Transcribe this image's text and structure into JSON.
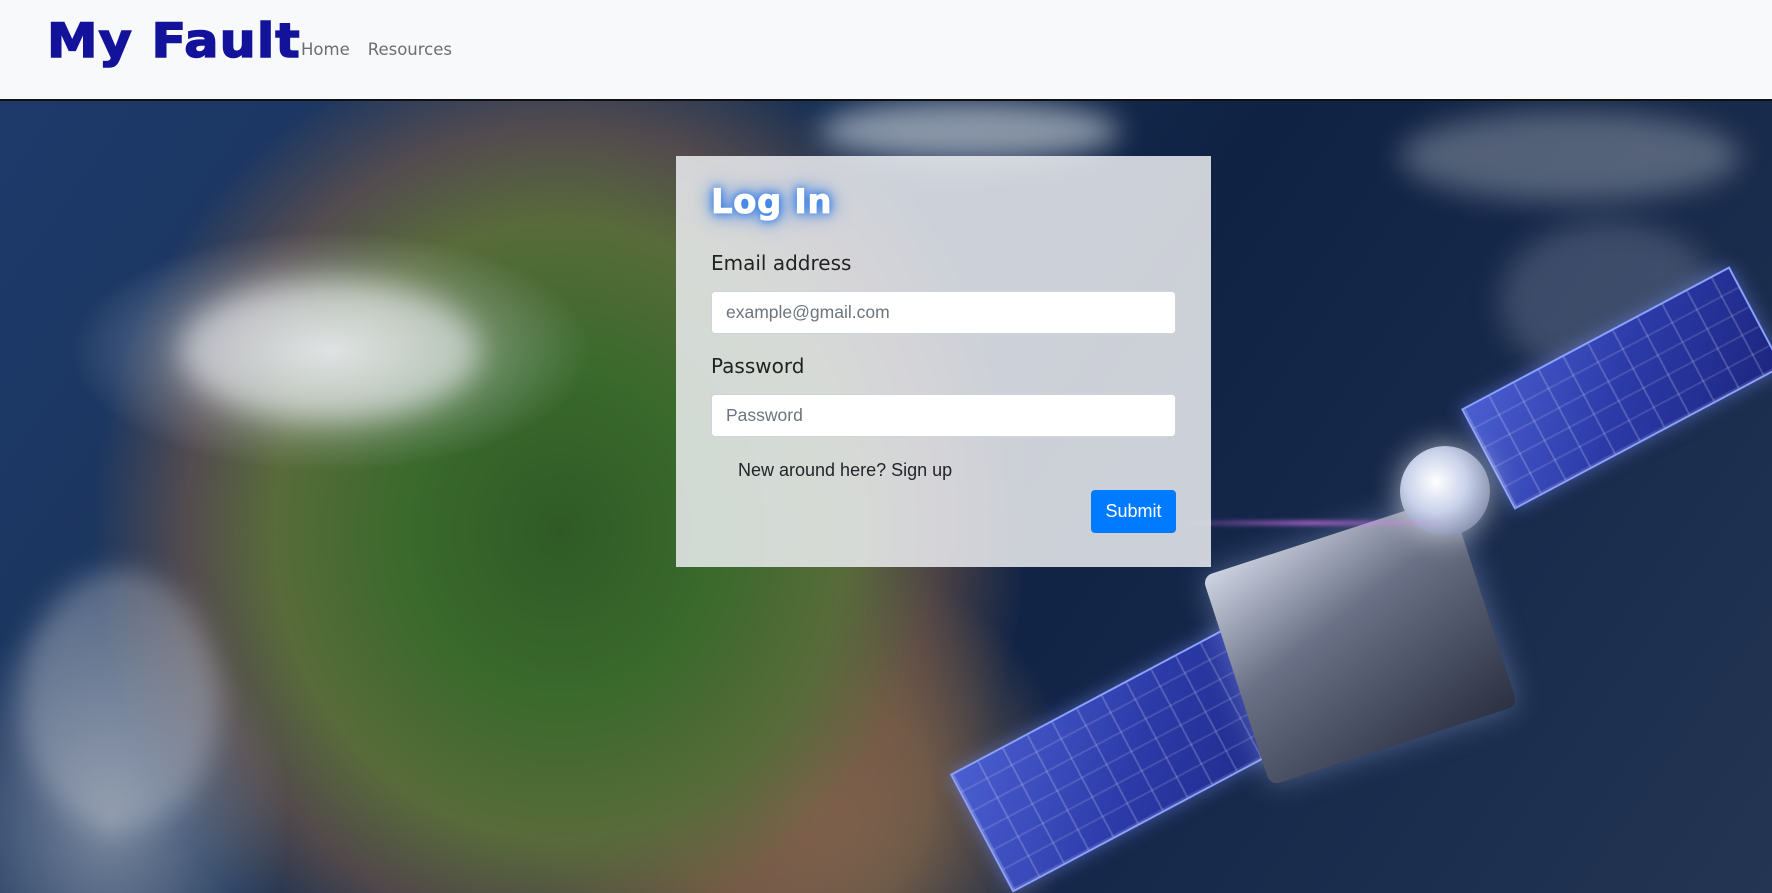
{
  "navbar": {
    "brand": "My Fault",
    "links": [
      {
        "label": "Home"
      },
      {
        "label": "Resources"
      }
    ]
  },
  "login": {
    "title": "Log In",
    "email_label": "Email address",
    "email_placeholder": "example@gmail.com",
    "password_label": "Password",
    "password_placeholder": "Password",
    "signup_text": "New around here? Sign up",
    "submit_label": "Submit"
  },
  "colors": {
    "brand": "#12129a",
    "primary_button": "#007bff",
    "navbar_bg": "#f8f9fa"
  }
}
